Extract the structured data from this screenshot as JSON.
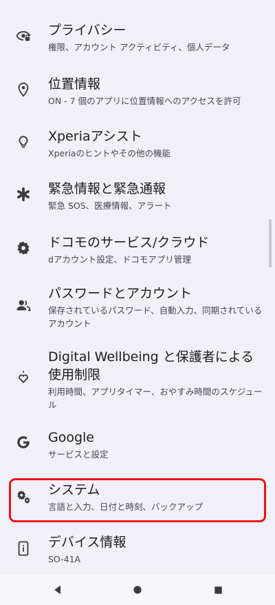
{
  "settings": {
    "items": [
      {
        "icon": "privacy-eye-lock-icon",
        "title": "プライバシー",
        "subtitle": "権限、アカウント アクティビティ、個人データ"
      },
      {
        "icon": "location-pin-icon",
        "title": "位置情報",
        "subtitle": "ON - 7 個のアプリに位置情報へのアクセスを許可"
      },
      {
        "icon": "lightbulb-icon",
        "title": "Xperiaアシスト",
        "subtitle": "Xperiaのヒントやその他の機能"
      },
      {
        "icon": "emergency-asterisk-icon",
        "title": "緊急情報と緊急通報",
        "subtitle": "緊急 SOS、医療情報、アラート"
      },
      {
        "icon": "gear-icon",
        "title": "ドコモのサービス/クラウド",
        "subtitle": "dアカウント設定、ドコモアプリ管理"
      },
      {
        "icon": "account-key-icon",
        "title": "パスワードとアカウント",
        "subtitle": "保存されているパスワード、自動入力、同期されているアカウント"
      },
      {
        "icon": "wellbeing-heart-icon",
        "title": "Digital Wellbeing と保護者による使用制限",
        "subtitle": "利用時間、アプリタイマー、おやすみ時間のスケジュール"
      },
      {
        "icon": "google-g-icon",
        "title": "Google",
        "subtitle": "サービスと設定"
      },
      {
        "icon": "system-gears-icon",
        "title": "システム",
        "subtitle": "言語と入力、日付と時刻、バックアップ"
      },
      {
        "icon": "device-info-icon",
        "title": "デバイス情報",
        "subtitle": "SO-41A"
      }
    ]
  },
  "colors": {
    "background": "#f1f0f6",
    "highlight": "#e8121c"
  }
}
